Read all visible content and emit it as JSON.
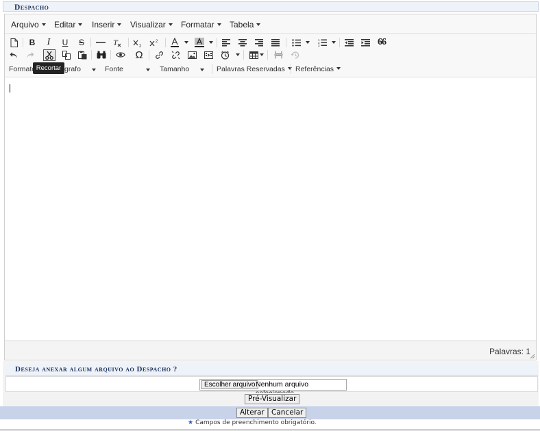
{
  "section": {
    "title": "Despacho"
  },
  "menubar": {
    "items": [
      {
        "label": "Arquivo"
      },
      {
        "label": "Editar"
      },
      {
        "label": "Inserir"
      },
      {
        "label": "Visualizar"
      },
      {
        "label": "Formatar"
      },
      {
        "label": "Tabela"
      }
    ]
  },
  "toolbar": {
    "tooltip": "Recortar",
    "combos": {
      "format": "Formato",
      "paragraph": "grafo",
      "font": "Fonte",
      "size": "Tamanho",
      "reserved": "Palavras Reservadas",
      "references": "Referências"
    },
    "glyphs": {
      "bold": "B",
      "italic": "I",
      "underline": "U",
      "strike": "S",
      "omega": "Ω",
      "quote": "66"
    }
  },
  "statusbar": {
    "word_count": "Palavras: 1"
  },
  "attachment": {
    "title": "Deseja anexar algum arquivo ao Despacho ?",
    "choose_button": "Escolher arquivo",
    "status": "Nenhum arquivo selecionado"
  },
  "buttons": {
    "preview": "Pré-Visualizar",
    "alter": "Alterar",
    "cancel": "Cancelar"
  },
  "footer": {
    "star": "★",
    "required_note": "Campos de preenchimento obrigatório."
  },
  "colors": {
    "section_title": "#1a2f5a",
    "action_bar": "#c8d3ea",
    "required_star": "#3355aa"
  }
}
